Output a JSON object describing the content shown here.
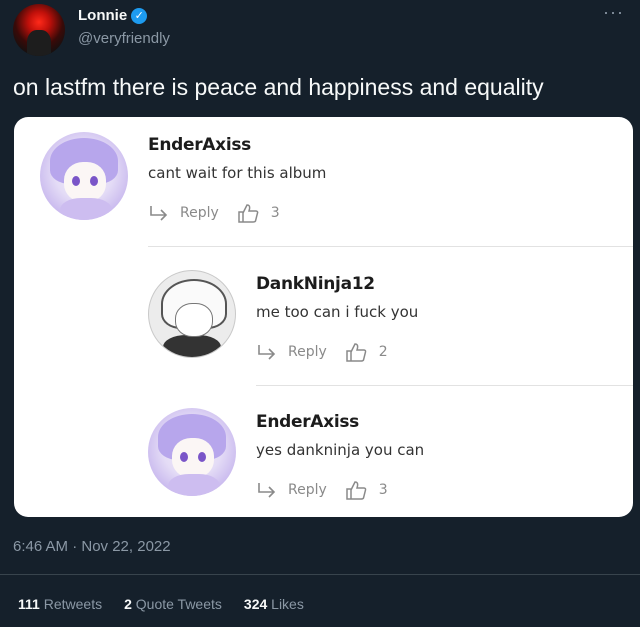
{
  "author": {
    "name": "Lonnie",
    "handle": "@veryfriendly",
    "verified_mark": "✓"
  },
  "more_glyph": "···",
  "tweet_text": "on lastfm there is peace and happiness and equality",
  "comments": [
    {
      "user": "EnderAxiss",
      "text": "cant wait for this album",
      "reply_label": "Reply",
      "likes": "3"
    },
    {
      "user": "DankNinja12",
      "text": "me too can i fuck you",
      "reply_label": "Reply",
      "likes": "2"
    },
    {
      "user": "EnderAxiss",
      "text": "yes dankninja you can",
      "reply_label": "Reply",
      "likes": "3"
    }
  ],
  "timestamp": "6:46 AM · Nov 22, 2022",
  "stats": {
    "retweets_count": "111",
    "retweets_label": "Retweets",
    "quotes_count": "2",
    "quotes_label": "Quote Tweets",
    "likes_count": "324",
    "likes_label": "Likes"
  },
  "colors": {
    "background": "#15202b",
    "verified": "#1d9bf0",
    "secondary_text": "#8b98a5"
  }
}
